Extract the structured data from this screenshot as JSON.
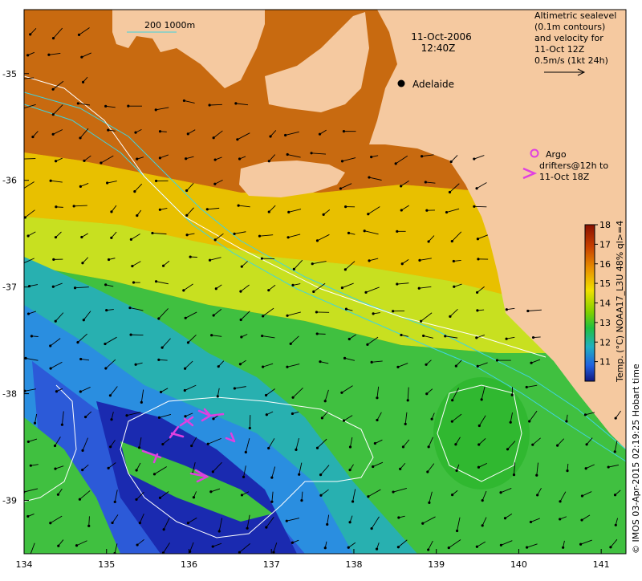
{
  "map": {
    "datetime": {
      "date": "11-Oct-2006",
      "time": "12:40Z"
    },
    "city": "Adelaide",
    "legend_velocity": {
      "lines": [
        "Altimetric sealevel",
        "(0.1m contours)",
        "and velocity for",
        "11-Oct 12Z",
        "0.5m/s (1kt 24h)"
      ]
    },
    "legend_argo": {
      "label": "Argo"
    },
    "legend_drifters": {
      "lines": [
        "drifters@12h to",
        "11-Oct 18Z"
      ]
    },
    "bathymetry_label": "200  1000m",
    "colorbar": {
      "title": "Temp. (°C) NOAA17_L3U 48% ql>=4",
      "min": 10,
      "max": 18,
      "ticks": [
        "18",
        "17",
        "16",
        "15",
        "14",
        "13",
        "12",
        "11"
      ]
    },
    "credit": "© IMOS 03-Apr-2015 02:19:25 Hobart time",
    "axes": {
      "x_ticks": [
        "134",
        "135",
        "136",
        "137",
        "138",
        "139",
        "140",
        "141"
      ],
      "y_ticks": [
        "-35",
        "-36",
        "-37",
        "-38",
        "-39"
      ],
      "xlim": [
        134,
        141.3
      ],
      "ylim": [
        -39.5,
        -34.4
      ]
    },
    "colors": {
      "land": "#f5c9a0",
      "argo": "#e040e0",
      "drifter": "#e040e0",
      "contour": "#ffffff",
      "bathy": "#3fd4e0"
    }
  }
}
